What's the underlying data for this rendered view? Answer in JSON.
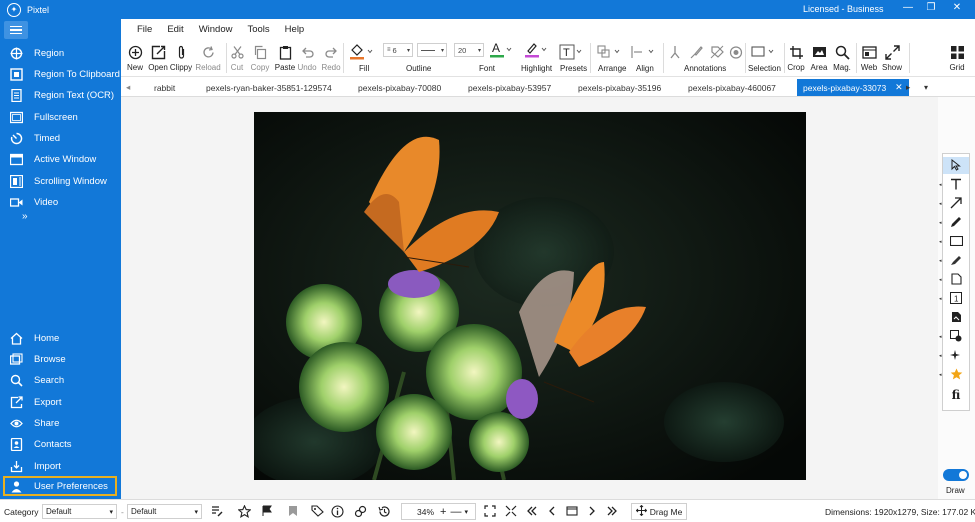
{
  "app": {
    "title": "Pixtel",
    "license": "Licensed - Business"
  },
  "window_controls": [
    "minimize",
    "restore",
    "close"
  ],
  "sidebar": {
    "capture_items": [
      {
        "label": "Region",
        "icon": "crosshair-icon"
      },
      {
        "label": "Region To Clipboard",
        "icon": "clipboard-capture-icon"
      },
      {
        "label": "Region Text (OCR)",
        "icon": "ocr-text-icon"
      },
      {
        "label": "Fullscreen",
        "icon": "fullscreen-icon"
      },
      {
        "label": "Timed",
        "icon": "timer-icon"
      },
      {
        "label": "Active Window",
        "icon": "window-icon"
      },
      {
        "label": "Scrolling Window",
        "icon": "scroll-window-icon"
      },
      {
        "label": "Video",
        "icon": "video-icon"
      }
    ],
    "more": "»",
    "bottom_items": [
      {
        "label": "Home",
        "icon": "home-icon"
      },
      {
        "label": "Browse",
        "icon": "browse-icon"
      },
      {
        "label": "Search",
        "icon": "search-icon"
      },
      {
        "label": "Export",
        "icon": "export-icon"
      },
      {
        "label": "Share",
        "icon": "share-icon"
      },
      {
        "label": "Contacts",
        "icon": "contacts-icon"
      },
      {
        "label": "Import",
        "icon": "import-icon"
      },
      {
        "label": "User Preferences",
        "icon": "user-icon"
      }
    ]
  },
  "menu": [
    "File",
    "Edit",
    "Window",
    "Tools",
    "Help"
  ],
  "toolbar": {
    "new": "New",
    "open": "Open",
    "clippy": "Clippy",
    "reload": "Reload",
    "cut": "Cut",
    "copy": "Copy",
    "paste": "Paste",
    "undo": "Undo",
    "redo": "Redo",
    "fill": "Fill",
    "outline_width": "6",
    "outline": "Outline",
    "font_size": "20",
    "font": "Font",
    "highlight": "Highlight",
    "presets": "Presets",
    "arrange": "Arrange",
    "align": "Align",
    "annotations": "Annotations",
    "selection": "Selection",
    "crop": "Crop",
    "area": "Area",
    "mag": "Mag.",
    "web": "Web",
    "show": "Show",
    "grid": "Grid"
  },
  "tabs": [
    "rabbit",
    "pexels-ryan-baker-35851-129574",
    "pexels-pixabay-70080",
    "pexels-pixabay-53957",
    "pexels-pixabay-35196",
    "pexels-pixabay-460067",
    "pexels-pixabay-33073"
  ],
  "active_tab": "pexels-pixabay-33073",
  "right_tools": [
    "pointer-icon",
    "text-tool-icon",
    "arrow-tool-icon",
    "pen-tool-icon",
    "rectangle-tool-icon",
    "highlighter-tool-icon",
    "note-tool-icon",
    "step-number-icon",
    "stamp-icon",
    "blur-icon",
    "magic-icon",
    "star-icon",
    "special-char-icon"
  ],
  "draw_toggle_label": "Draw",
  "statusbar": {
    "category_label": "Category",
    "category_value": "Default",
    "second_value": "Default",
    "zoom": "34%",
    "drag_me": "Drag Me",
    "dimensions": "Dimensions: 1920x1279, Size: 177.02 KB"
  },
  "colors": {
    "accent": "#1278d8",
    "fill_swatch": "#e8762a",
    "font_swatch": "#2da84a",
    "highlight_swatch": "#c44ad6",
    "star": "#f2a516"
  }
}
